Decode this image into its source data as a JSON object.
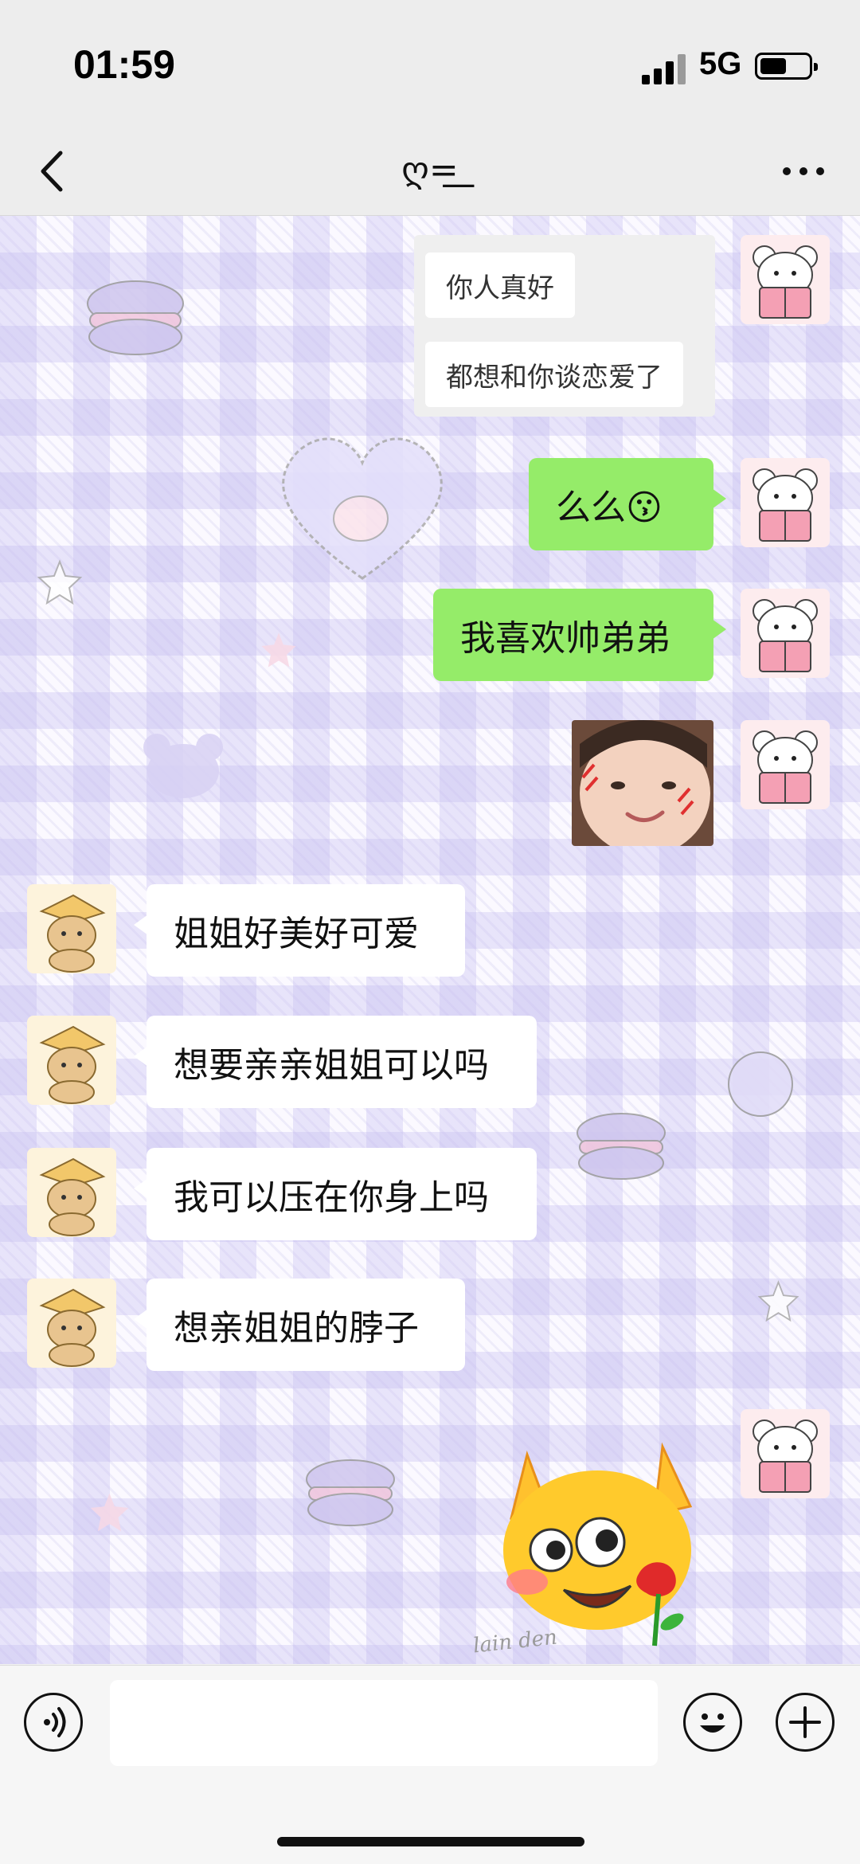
{
  "status_bar": {
    "time": "01:59",
    "network": "5G",
    "battery_level": 0.55
  },
  "header": {
    "title": "ღ=͟͟",
    "back_icon": "chevron-left-icon",
    "more_icon": "more-dots-icon"
  },
  "quoted_messages": [
    "你人真好",
    "都想和你谈恋爱了"
  ],
  "sent_messages": [
    {
      "text": "么么😗"
    },
    {
      "text": "我喜欢帅弟弟"
    }
  ],
  "received_messages": [
    {
      "text": "姐姐好美好可爱"
    },
    {
      "text": "想要亲亲姐姐可以吗"
    },
    {
      "text": "我可以压在你身上吗"
    },
    {
      "text": "想亲姐姐的脖子"
    }
  ],
  "sticker_watermark": "lain  den",
  "input_bar": {
    "voice_icon": "voice-icon",
    "emoji_icon": "emoji-icon",
    "plus_icon": "plus-icon",
    "value": ""
  },
  "colors": {
    "sent_bubble": "#95ec69",
    "received_bubble": "#ffffff",
    "bar_bg": "#ededed"
  }
}
